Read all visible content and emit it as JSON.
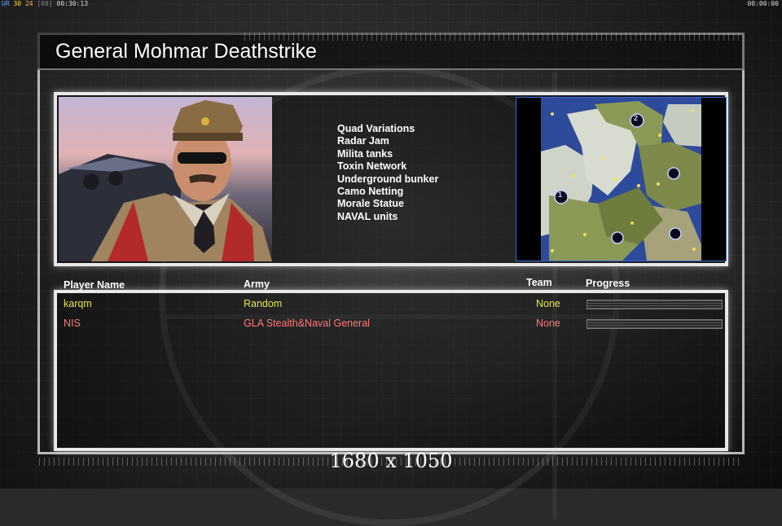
{
  "hud": {
    "ur": "UR",
    "n1": "30",
    "n2": "24",
    "n3": "[60]",
    "time_left": "00:30:13",
    "time_right": "00:00:00"
  },
  "title": "General Mohmar Deathstrike",
  "features": [
    "Quad Variations",
    "Radar Jam",
    "Milita tanks",
    "Toxin Network",
    "Underground bunker",
    "Camo Netting",
    "Morale Statue",
    "NAVAL units"
  ],
  "minimap": {
    "start_positions": [
      "1",
      "2"
    ]
  },
  "table": {
    "headers": {
      "player": "Player Name",
      "army": "Army",
      "team": "Team",
      "progress": "Progress"
    },
    "rows": [
      {
        "player": "karqm",
        "army": "Random",
        "team": "None",
        "progress": 0,
        "color": "#e6e64a"
      },
      {
        "player": "NIS",
        "army": "GLA Stealth&Naval General",
        "team": "None",
        "progress": 0,
        "color": "#ff7a7a"
      }
    ]
  },
  "resolution": "1680 x 1050",
  "colors": {
    "accent_frame": "#e8e8e8",
    "minimap_border": "#3a6ad8"
  }
}
